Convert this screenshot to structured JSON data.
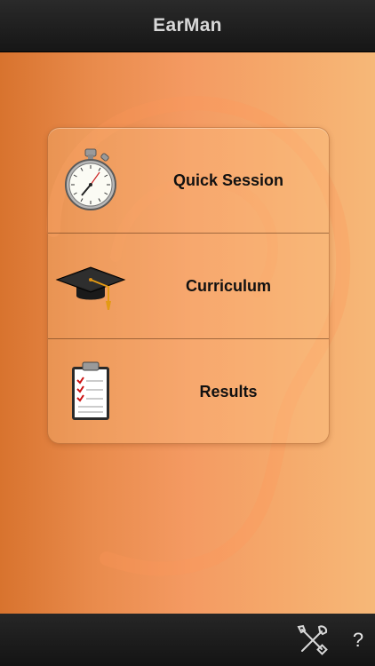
{
  "app": {
    "title": "EarMan"
  },
  "menu": {
    "items": [
      {
        "label": "Quick Session",
        "icon": "stopwatch-icon"
      },
      {
        "label": "Curriculum",
        "icon": "graduation-cap-icon"
      },
      {
        "label": "Results",
        "icon": "clipboard-checklist-icon"
      }
    ]
  },
  "toolbar": {
    "settings_icon": "tools-icon",
    "help_label": "?"
  },
  "colors": {
    "nav_bar": "#1e1e1e",
    "background_left": "#d8732e",
    "background_right": "#f6b878",
    "label_text": "#111111"
  }
}
